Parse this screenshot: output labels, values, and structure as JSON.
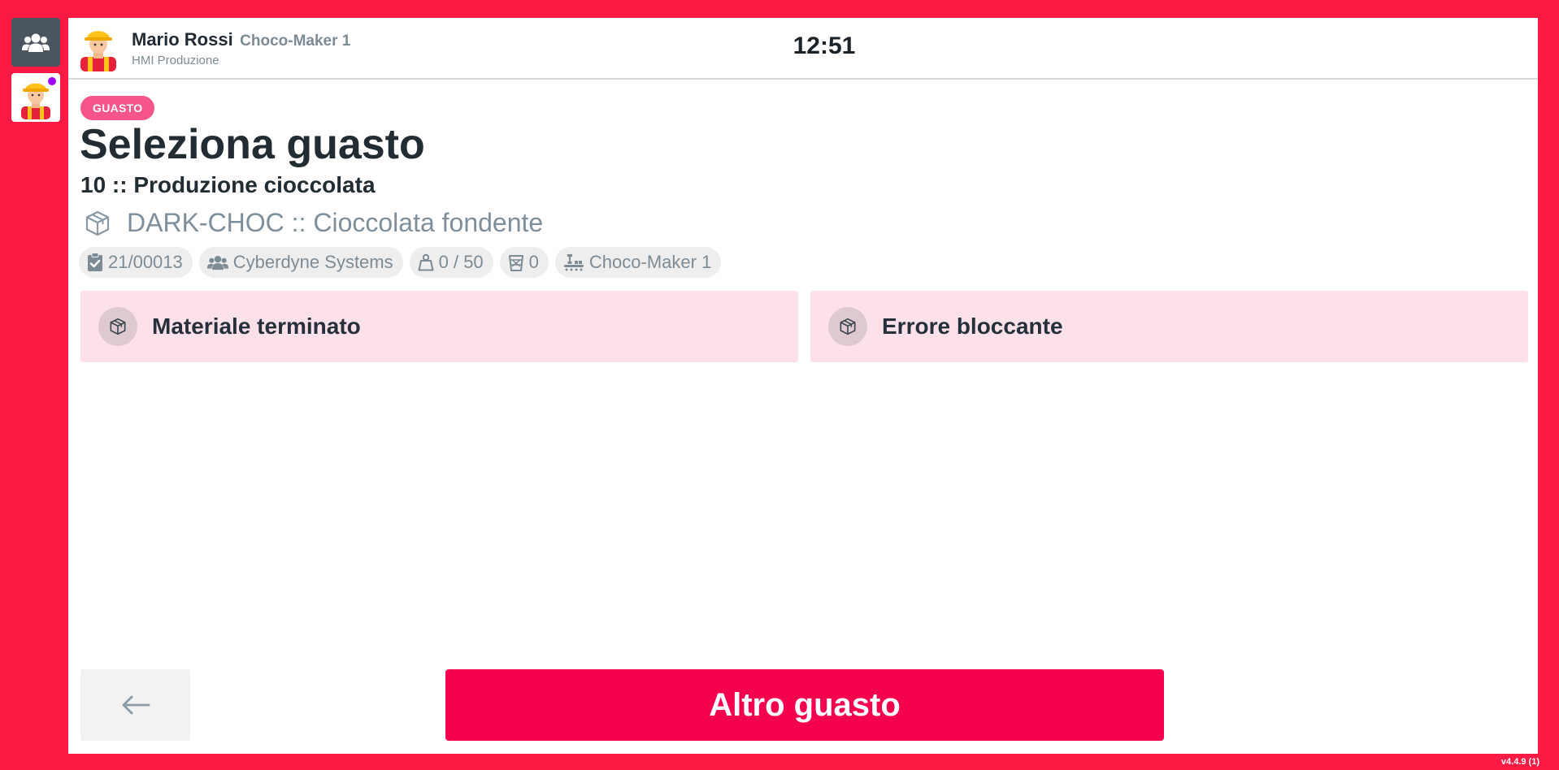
{
  "sidebar": {
    "items": [
      {
        "icon": "users-group-icon"
      },
      {
        "icon": "worker-avatar-icon",
        "status_color": "#a400ff"
      }
    ]
  },
  "header": {
    "user_name": "Mario Rossi",
    "machine": "Choco-Maker 1",
    "role": "HMI Produzione",
    "clock": "12:51"
  },
  "page": {
    "badge": "GUASTO",
    "title": "Seleziona guasto",
    "operation": "10 :: Produzione cioccolata",
    "product": "DARK-CHOC :: Cioccolata fondente"
  },
  "chips": {
    "order": "21/00013",
    "customer": "Cyberdyne Systems",
    "quantity": "0 / 50",
    "waste": "0",
    "machine": "Choco-Maker 1"
  },
  "faults": [
    {
      "label": "Materiale terminato",
      "icon": "box-icon"
    },
    {
      "label": "Errore bloccante",
      "icon": "box-icon"
    }
  ],
  "footer": {
    "back_icon": "arrow-left-icon",
    "primary_label": "Altro guasto",
    "version": "v4.4.9 (1)"
  },
  "colors": {
    "frame": "#fb1a43",
    "badge": "#f5558a",
    "primary": "#f5004f",
    "card": "#fde1ea"
  }
}
